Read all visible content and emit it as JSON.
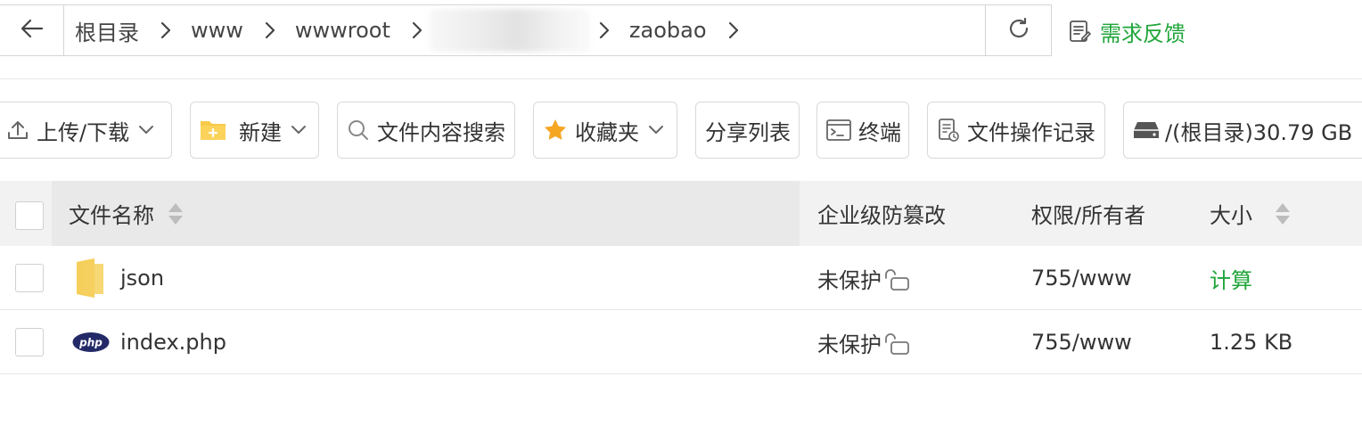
{
  "breadcrumb": {
    "items": [
      "根目录",
      "www",
      "wwwroot",
      "zaobao"
    ]
  },
  "header": {
    "feedback_label": "需求反馈"
  },
  "toolbar": {
    "upload_download": "上传/下载",
    "new": "新建",
    "search_content": "文件内容搜索",
    "favorites": "收藏夹",
    "share_list": "分享列表",
    "terminal": "终端",
    "operation_log": "文件操作记录",
    "disk": "/(根目录)30.79 GB"
  },
  "table": {
    "columns": {
      "name": "文件名称",
      "protection": "企业级防篡改",
      "permission": "权限/所有者",
      "size": "大小"
    },
    "rows": [
      {
        "type": "folder",
        "name": "json",
        "protection": "未保护",
        "permission": "755/www",
        "size": "计算"
      },
      {
        "type": "php",
        "name": "index.php",
        "protection": "未保护",
        "permission": "755/www",
        "size": "1.25 KB"
      }
    ]
  },
  "colors": {
    "accent": "#20a53a",
    "folder": "#f7c948",
    "php_badge": "#232a67",
    "star": "#f5a623"
  }
}
